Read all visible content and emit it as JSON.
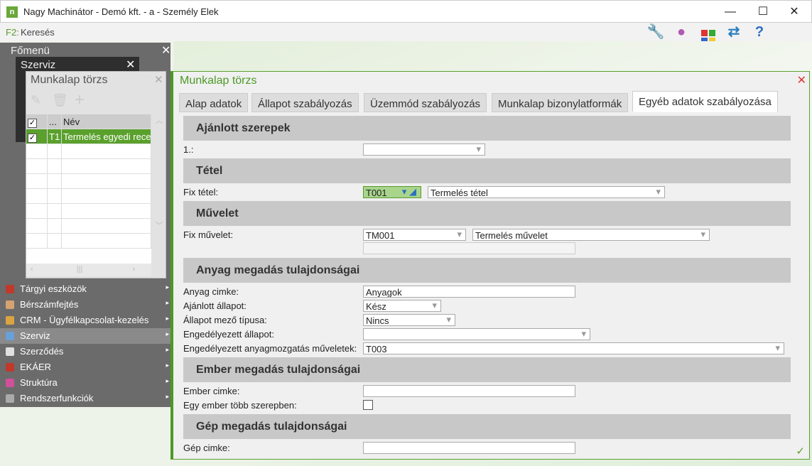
{
  "window": {
    "title": "Nagy Machinátor - Demó kft. - a - Személy Elek",
    "logo": "n"
  },
  "toolbar": {
    "shortcut_key": "F2:",
    "shortcut_label": "Keresés",
    "icons": [
      "wrench-icon",
      "user-icon",
      "apps-icon",
      "swap-icon",
      "help-icon"
    ]
  },
  "main_menu": {
    "title": "Főmenü",
    "items": [
      {
        "label": "Tárgyi eszközök",
        "color": "#c0392b"
      },
      {
        "label": "Bérszámfejtés",
        "color": "#d4a373"
      },
      {
        "label": "CRM - Ügyfélkapcsolat-kezelés",
        "color": "#d9a441"
      },
      {
        "label": "Szerviz",
        "color": "#6aa0d8",
        "active": true
      },
      {
        "label": "Szerződés",
        "color": "#e0e0e0"
      },
      {
        "label": "EKÁER",
        "color": "#c0392b"
      },
      {
        "label": "Struktúra",
        "color": "#d0509a"
      },
      {
        "label": "Rendszerfunkciók",
        "color": "#aaaaaa"
      }
    ]
  },
  "szerviz": {
    "title": "Szerviz"
  },
  "list_panel": {
    "title": "Munkalap törzs",
    "columns": [
      "",
      "...",
      "Név"
    ],
    "rows": [
      {
        "checked": true,
        "code": "T1",
        "name": "Termelés egyedi recept"
      }
    ]
  },
  "panel": {
    "title": "Munkalap törzs",
    "tabs": [
      "Alap adatok",
      "Állapot szabályozás",
      "Üzemmód szabályozás",
      "Munkalap bizonylatformák",
      "Egyéb adatok szabályozása"
    ],
    "active_tab": 4,
    "sections": {
      "roles": {
        "title": "Ajánlott szerepek",
        "row_label": "1.:",
        "value": ""
      },
      "item": {
        "title": "Tétel",
        "label": "Fix tétel:",
        "code": "T001",
        "name": "Termelés tétel"
      },
      "operation": {
        "title": "Művelet",
        "label": "Fix művelet:",
        "code": "TM001",
        "name": "Termelés művelet",
        "extra": ""
      },
      "material": {
        "title": "Anyag megadás tulajdonságai",
        "rows": [
          {
            "label": "Anyag cimke:",
            "value": "Anyagok"
          },
          {
            "label": "Ajánlott állapot:",
            "value": "Kész"
          },
          {
            "label": "Állapot mező típusa:",
            "value": "Nincs"
          },
          {
            "label": "Engedélyezett állapot:",
            "value": ""
          },
          {
            "label": "Engedélyezett anyagmozgatás műveletek:",
            "value": "T003"
          }
        ]
      },
      "person": {
        "title": "Ember megadás tulajdonságai",
        "label_tag": "Ember cimke:",
        "tag_value": "",
        "label_multi": "Egy ember több szerepben:",
        "multi": false
      },
      "machine": {
        "title": "Gép megadás tulajdonságai",
        "label_tag": "Gép cimke:",
        "tag_value": ""
      }
    }
  }
}
